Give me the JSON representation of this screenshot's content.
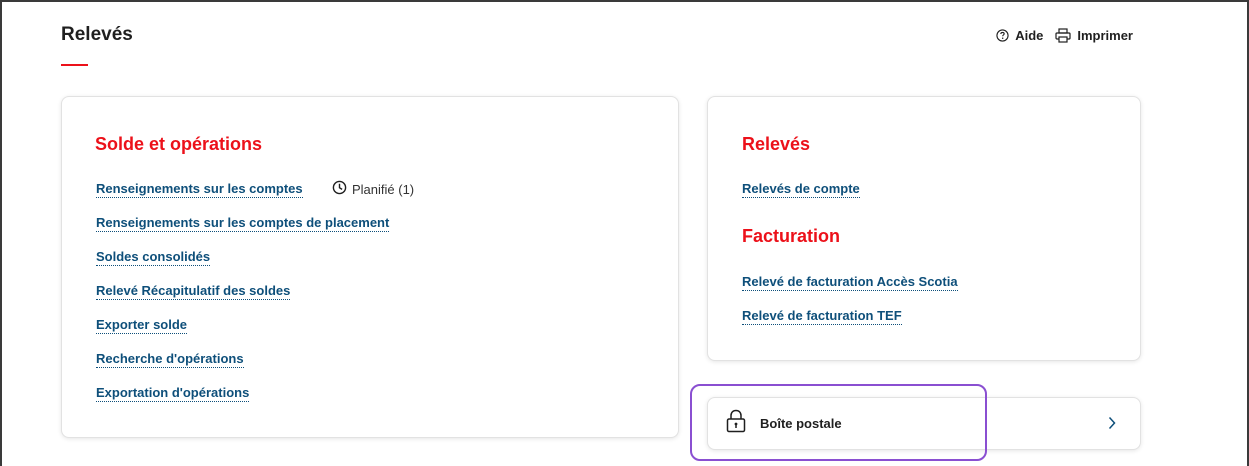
{
  "page": {
    "title": "Relevés",
    "accent_color": "#ec111a",
    "link_color": "#0e4f7a"
  },
  "actions": {
    "help": {
      "label": "Aide",
      "icon": "help-circle-icon"
    },
    "print": {
      "label": "Imprimer",
      "icon": "printer-icon"
    }
  },
  "balances_card": {
    "title": "Solde et opérations",
    "links": [
      "Renseignements sur les comptes",
      "Renseignements sur les comptes de placement",
      "Soldes consolidés",
      "Relevé Récapitulatif des soldes",
      "Exporter solde",
      "Recherche d'opérations",
      "Exportation d'opérations"
    ],
    "scheduled": {
      "icon": "clock-icon",
      "label": "Planifié (1)"
    }
  },
  "statements_card": {
    "statements_title": "Relevés",
    "statements_links": [
      "Relevés de compte"
    ],
    "billing_title": "Facturation",
    "billing_links": [
      "Relevé de facturation Accès Scotia",
      "Relevé de facturation TEF"
    ]
  },
  "mailbox": {
    "label": "Boîte postale",
    "icon": "lock-icon",
    "chevron_icon": "chevron-right-icon",
    "highlight_color": "#8a4fd1"
  }
}
